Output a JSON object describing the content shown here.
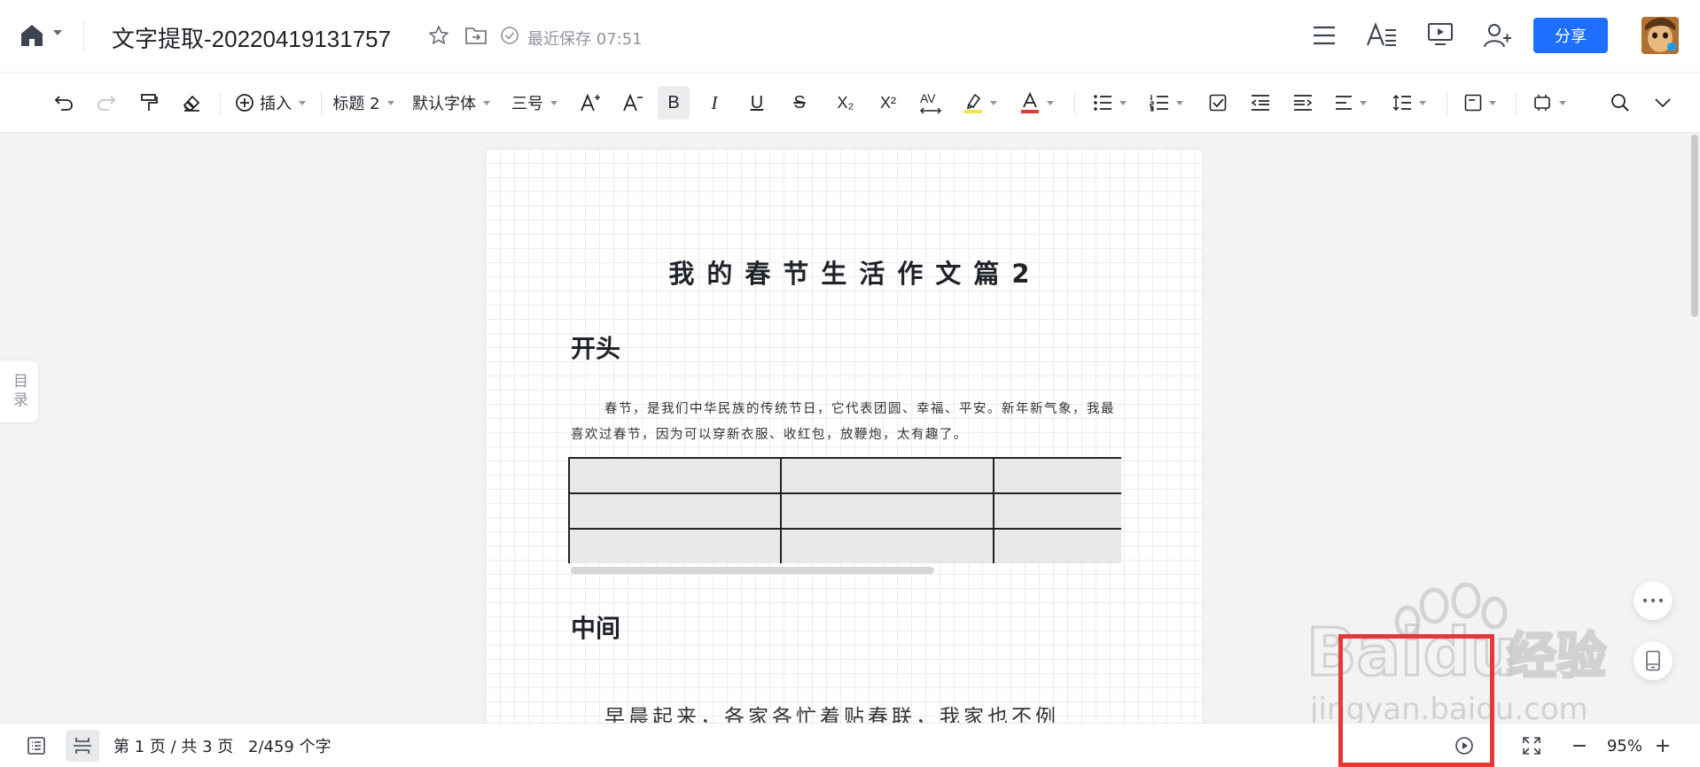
{
  "header": {
    "title": "文字提取-20220419131757",
    "save_status": "最近保存 07:51",
    "share_label": "分享"
  },
  "toolbar": {
    "insert_label": "插入",
    "heading_style": "标题 2",
    "font_family": "默认字体",
    "font_size": "三号",
    "bold": "B",
    "italic": "I",
    "underline": "U",
    "strikethrough": "S",
    "subscript": "X₂",
    "superscript": "X²",
    "spacing": "AV",
    "highlight_color": "#f2e64a",
    "font_color": "#e53935"
  },
  "sidebar": {
    "toc_label": "目录"
  },
  "document": {
    "title": "我的春节生活作文篇2",
    "section1_heading": "开头",
    "section1_para": "春节，是我们中华民族的传统节日，它代表团圆、幸福、平安。新年新气象，我最喜欢过春节，因为可以穿新衣服、收红包，放鞭炮，太有趣了。",
    "section2_heading": "中间",
    "section2_para": "早晨起来，各家各忙着贴春联，我家也不例"
  },
  "statusbar": {
    "page_info": "第 1 页 / 共 3 页",
    "word_count": "2/459 个字",
    "zoom": "95%"
  },
  "watermark": {
    "brand": "Baidu",
    "suffix": "经验",
    "url": "jingyan.baidu.com"
  },
  "colors": {
    "accent": "#1e6fff",
    "highlight_box": "#e53935"
  }
}
